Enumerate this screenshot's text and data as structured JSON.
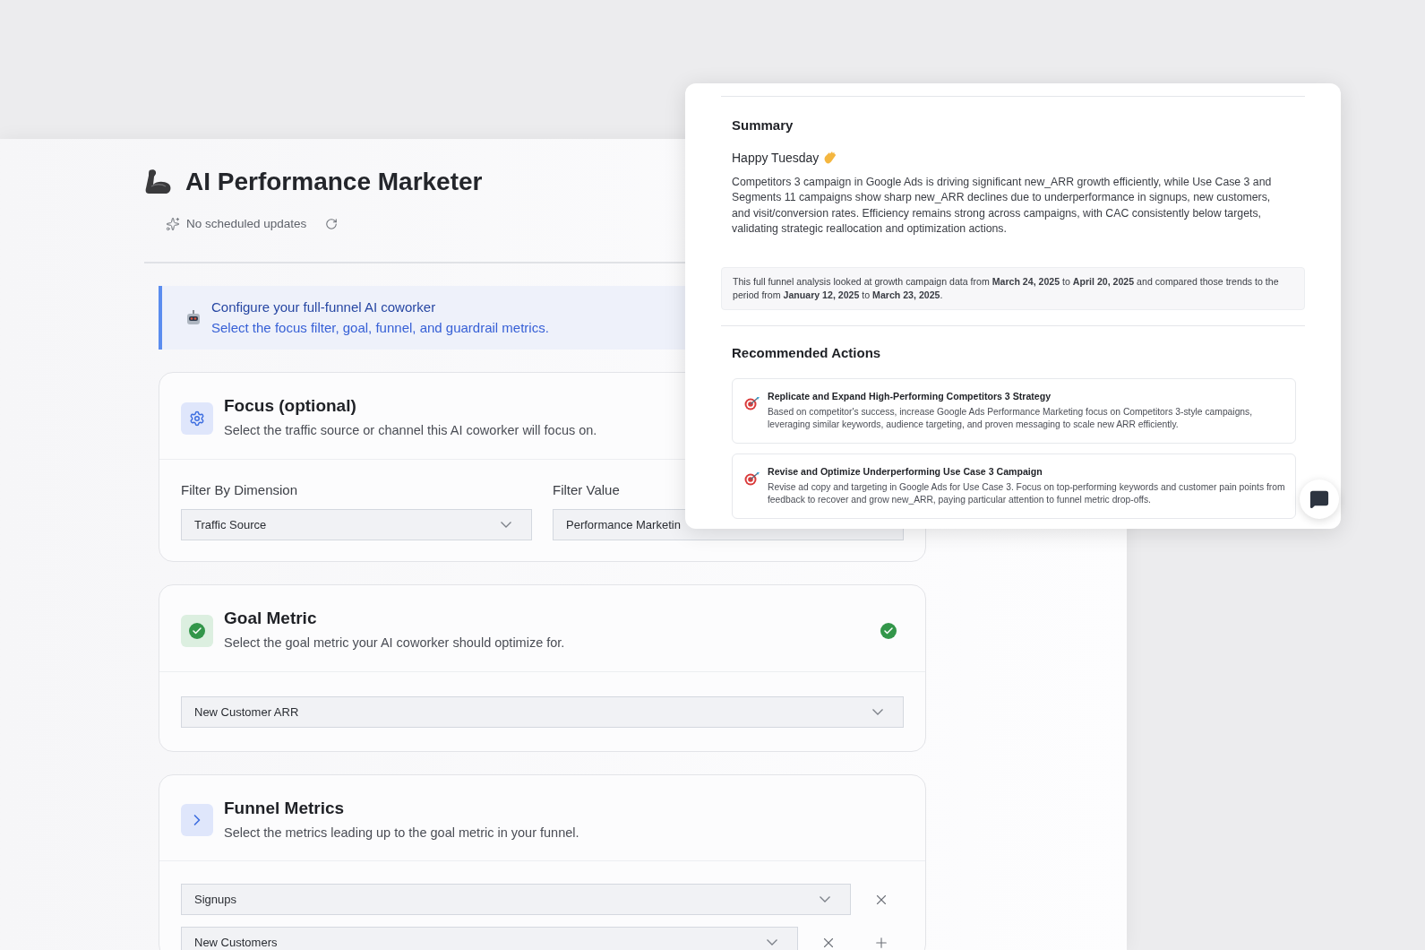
{
  "header": {
    "title": "AI Performance Marketer",
    "schedule": "No scheduled updates"
  },
  "banner": {
    "title": "Configure your full-funnel AI coworker",
    "text": "Select the focus filter, goal, funnel, and guardrail metrics."
  },
  "sections": [
    {
      "kind": "filters",
      "title": "Focus (optional)",
      "description": "Select the traffic source or channel this AI coworker will focus on.",
      "completed": false,
      "filters": [
        {
          "label": "Filter By Dimension",
          "value": "Traffic Source"
        },
        {
          "label": "Filter Value",
          "value": "Performance Marketin"
        }
      ]
    },
    {
      "kind": "single",
      "title": "Goal Metric",
      "description": "Select the goal metric your AI coworker should optimize for.",
      "completed": true,
      "value": "New Customer ARR"
    },
    {
      "kind": "list",
      "title": "Funnel Metrics",
      "description": "Select the metrics leading up to the goal metric in your funnel.",
      "completed": false,
      "rows": [
        {
          "value": "Signups",
          "addable": false
        },
        {
          "value": "New Customers",
          "addable": true
        }
      ]
    }
  ],
  "report": {
    "summary_title": "Summary",
    "greeting": "Happy Tuesday",
    "summary": "Competitors 3 campaign in Google Ads is driving significant new_ARR growth efficiently, while Use Case 3 and Segments 11 campaigns show sharp new_ARR declines due to underperformance in signups, new customers, and visit/conversion rates. Efficiency remains strong across campaigns, with CAC consistently below targets, validating strategic reallocation and optimization actions.",
    "analysis_note": "This full funnel analysis looked at growth campaign data from **March 24, 2025** to **April 20, 2025** and compared those trends to the period from **January 12, 2025** to **March 23, 2025**.",
    "actions_title": "Recommended Actions",
    "actions": [
      {
        "title": "Replicate and Expand High-Performing Competitors 3 Strategy",
        "text": "Based on competitor's success, increase Google Ads Performance Marketing focus on Competitors 3-style campaigns, leveraging similar keywords, audience targeting, and proven messaging to scale new ARR efficiently."
      },
      {
        "title": "Revise and Optimize Underperforming Use Case 3 Campaign",
        "text": "Revise ad copy and targeting in Google Ads for Use Case 3. Focus on top-performing keywords and customer pain points from feedback to recover and grow new_ARR, paying particular attention to funnel metric drop-offs."
      }
    ]
  }
}
